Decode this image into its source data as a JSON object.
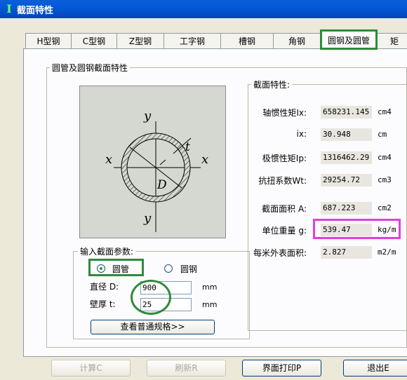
{
  "window": {
    "title": "截面特性",
    "icon": "steel-beam-icon"
  },
  "tabs": [
    "H型钢",
    "C型钢",
    "Z型钢",
    "工字钢",
    "槽钢",
    "角钢",
    "圆钢及圆管",
    "矩"
  ],
  "active_tab": "圆钢及圆管",
  "section_group": {
    "title": "圆管及圆钢截面特性"
  },
  "figure": {
    "y_top": "y",
    "y_bottom": "y",
    "x_left": "x",
    "x_right": "x",
    "thickness": "t",
    "diameter": "D"
  },
  "input_group": {
    "title": "输入截面参数:",
    "radio_pipe": "圆管",
    "radio_steel": "圆钢",
    "selected": "圆管",
    "diameter_label": "直径 D:",
    "diameter_value": "900",
    "diameter_unit": "mm",
    "thickness_label": "壁厚 t:",
    "thickness_value": "25",
    "thickness_unit": "mm",
    "spec_button": "查看普通规格>>"
  },
  "properties": {
    "title": "截面特性:",
    "rows": [
      {
        "label": "轴惯性矩Ix:",
        "value": "658231.145",
        "unit": "cm4"
      },
      {
        "label": "ix:",
        "value": "30.948",
        "unit": "cm"
      },
      {
        "label": "极惯性矩Ip:",
        "value": "1316462.29",
        "unit": "cm4"
      },
      {
        "label": "抗扭系数Wt:",
        "value": "29254.72",
        "unit": "cm3"
      },
      {
        "label": "截面面积 A:",
        "value": "687.223",
        "unit": "cm2"
      },
      {
        "label": "单位重量 g:",
        "value": "539.47",
        "unit": "kg/m"
      },
      {
        "label": "每米外表面积:",
        "value": "2.827",
        "unit": "m2/m"
      }
    ]
  },
  "buttons": {
    "calc": "计算C",
    "refresh": "刷新R",
    "print": "界面打印P",
    "exit": "退出E"
  },
  "colors": {
    "highlight_green": "#2e8b3a",
    "highlight_pink": "#e040e0",
    "titlebar": "#0458d8"
  }
}
